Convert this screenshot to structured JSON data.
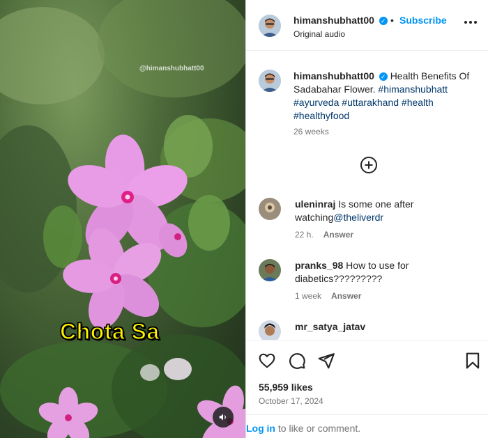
{
  "media": {
    "watermark": "@himanshubhatt00",
    "overlay_caption": "Chota Sa",
    "caption_color": "#fff200"
  },
  "header": {
    "username": "himanshubhatt00",
    "separator": "•",
    "subscribe_label": "Subscribe",
    "audio_label": "Original audio"
  },
  "caption": {
    "username": "himanshubhatt00",
    "text": "Health Benefits Of Sadabahar Flower.",
    "hashtags": [
      "#himanshubhatt",
      "#ayurveda",
      "#uttarakhand",
      "#health",
      "#healthyfood"
    ],
    "time": "26 weeks"
  },
  "comments": [
    {
      "username": "uleninraj",
      "text": "Is some one after watching",
      "mention": "@theliverdr",
      "time": "22 h.",
      "reply_label": "Answer"
    },
    {
      "username": "pranks_98",
      "text": "How to use for diabetics?????????",
      "time": "1 week",
      "reply_label": "Answer"
    },
    {
      "username": "mr_satya_jatav",
      "text": ""
    }
  ],
  "footer": {
    "likes": "55,959 likes",
    "date": "October 17, 2024",
    "login_link": "Log in",
    "login_rest": " to like or comment."
  },
  "colors": {
    "accent": "#0095f6",
    "text": "#262626",
    "muted": "#737373",
    "hashtag": "#00376b"
  },
  "icons": [
    "more-icon",
    "verified-icon",
    "add-circle-icon",
    "heart-icon",
    "comment-icon",
    "share-icon",
    "bookmark-icon",
    "volume-icon"
  ]
}
